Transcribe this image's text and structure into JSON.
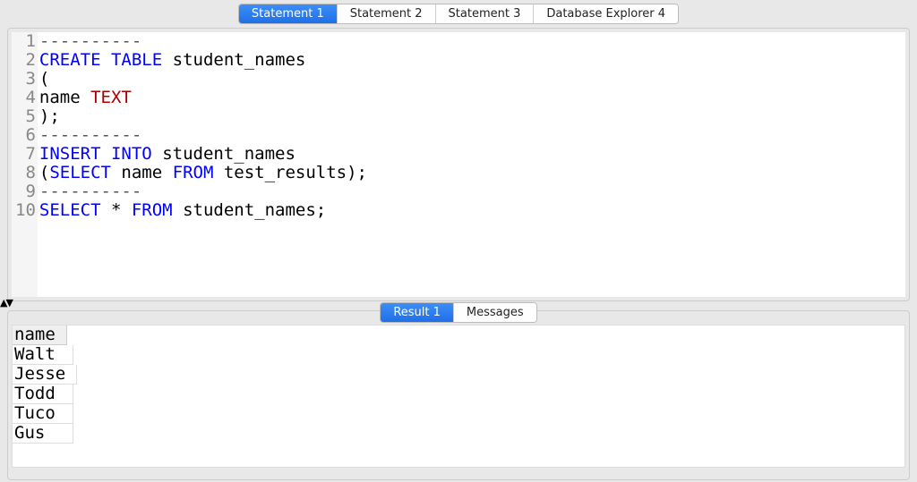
{
  "top_tabs": [
    {
      "label": "Statement 1",
      "active": true
    },
    {
      "label": "Statement 2",
      "active": false
    },
    {
      "label": "Statement 3",
      "active": false
    },
    {
      "label": "Database Explorer 4",
      "active": false
    }
  ],
  "editor": {
    "lines": [
      {
        "n": "1",
        "tokens": [
          {
            "t": "----------",
            "c": "cm"
          }
        ]
      },
      {
        "n": "2",
        "tokens": [
          {
            "t": "CREATE",
            "c": "kw"
          },
          {
            "t": " "
          },
          {
            "t": "TABLE",
            "c": "kw"
          },
          {
            "t": " student_names"
          }
        ]
      },
      {
        "n": "3",
        "tokens": [
          {
            "t": "("
          }
        ]
      },
      {
        "n": "4",
        "tokens": [
          {
            "t": "name "
          },
          {
            "t": "TEXT",
            "c": "ty"
          }
        ]
      },
      {
        "n": "5",
        "tokens": [
          {
            "t": ");"
          }
        ]
      },
      {
        "n": "6",
        "tokens": [
          {
            "t": "----------",
            "c": "cm"
          }
        ]
      },
      {
        "n": "7",
        "tokens": [
          {
            "t": "INSERT",
            "c": "kw"
          },
          {
            "t": " "
          },
          {
            "t": "INTO",
            "c": "kw"
          },
          {
            "t": " student_names"
          }
        ]
      },
      {
        "n": "8",
        "tokens": [
          {
            "t": "("
          },
          {
            "t": "SELECT",
            "c": "kw"
          },
          {
            "t": " name "
          },
          {
            "t": "FROM",
            "c": "kw"
          },
          {
            "t": " test_results);"
          }
        ]
      },
      {
        "n": "9",
        "tokens": [
          {
            "t": "----------",
            "c": "cm"
          }
        ]
      },
      {
        "n": "10",
        "tokens": [
          {
            "t": "SELECT",
            "c": "kw"
          },
          {
            "t": " * "
          },
          {
            "t": "FROM",
            "c": "kw"
          },
          {
            "t": " student_names;"
          }
        ]
      }
    ]
  },
  "result_tabs": [
    {
      "label": "Result 1",
      "active": true
    },
    {
      "label": "Messages",
      "active": false
    }
  ],
  "results": {
    "columns": [
      "name"
    ],
    "rows": [
      [
        "Walt"
      ],
      [
        "Jesse"
      ],
      [
        "Todd"
      ],
      [
        "Tuco"
      ],
      [
        "Gus"
      ]
    ]
  }
}
